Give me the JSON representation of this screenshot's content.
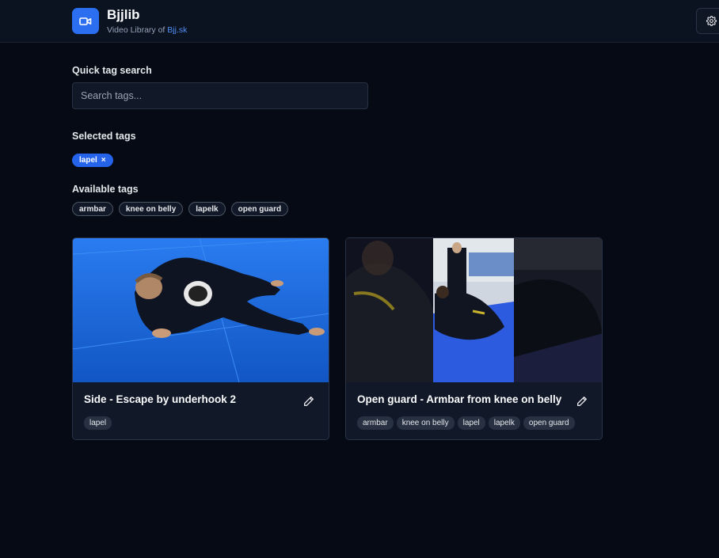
{
  "header": {
    "title": "Bjjlib",
    "subtitle_prefix": "Video Library of ",
    "subtitle_link": "Bjj.sk",
    "logo_icon": "video-camera-icon",
    "settings_icon": "gear-icon"
  },
  "search": {
    "label": "Quick tag search",
    "placeholder": "Search tags...",
    "value": ""
  },
  "selected": {
    "label": "Selected tags",
    "tags": [
      {
        "name": "lapel",
        "remove": "×"
      }
    ]
  },
  "available": {
    "label": "Available tags",
    "tags": [
      "armbar",
      "knee on belly",
      "lapelk",
      "open guard"
    ]
  },
  "videos": [
    {
      "title": "Side - Escape by underhook 2",
      "tags": [
        "lapel"
      ]
    },
    {
      "title": "Open guard - Armbar from knee on belly",
      "tags": [
        "armbar",
        "knee on belly",
        "lapel",
        "lapelk",
        "open guard"
      ]
    }
  ],
  "colors": {
    "accent": "#2563eb",
    "background": "#050a14",
    "surface": "#111827"
  }
}
